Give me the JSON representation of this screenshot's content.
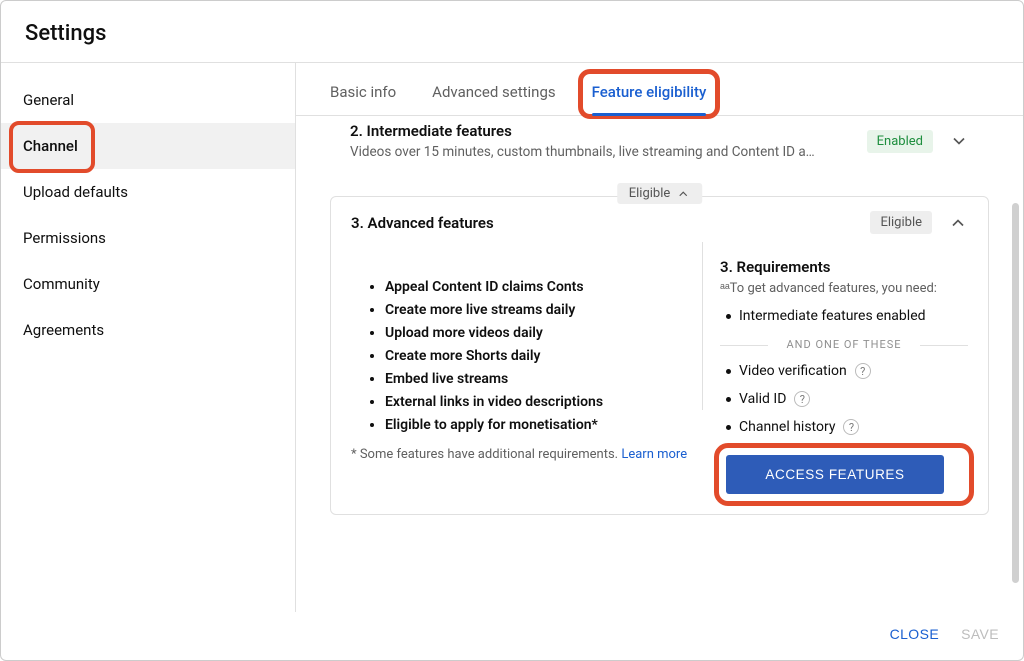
{
  "header": {
    "title": "Settings"
  },
  "sidebar": {
    "items": [
      {
        "label": "General"
      },
      {
        "label": "Channel"
      },
      {
        "label": "Upload defaults"
      },
      {
        "label": "Permissions"
      },
      {
        "label": "Community"
      },
      {
        "label": "Agreements"
      }
    ]
  },
  "tabs": [
    {
      "label": "Basic info"
    },
    {
      "label": "Advanced settings"
    },
    {
      "label": "Feature eligibility"
    }
  ],
  "intermediate": {
    "title": "2. Intermediate features",
    "subtitle": "Videos over 15 minutes, custom thumbnails, live streaming and Content ID a…",
    "status": "Enabled"
  },
  "advanced": {
    "eligible_pill": "Eligible",
    "title": "3. Advanced features",
    "status": "Eligible",
    "features": [
      "Appeal Content ID claims Conts",
      "Create more live streams daily",
      "Upload more videos daily",
      "Create more Shorts daily",
      "Embed live streams",
      "External links in video descriptions",
      "Eligible to apply for monetisation*"
    ],
    "footnote_text": "* Some features have additional requirements. ",
    "footnote_link": "Learn more",
    "requirements": {
      "title": "3. Requirements",
      "subtitle": "ᵃᵃTo get advanced features, you need:",
      "primary": "Intermediate features enabled",
      "and_label": "AND ONE OF THESE",
      "options": [
        "Video verification",
        "Valid ID",
        "Channel history"
      ],
      "button": "ACCESS FEATURES"
    }
  },
  "footer": {
    "close": "CLOSE",
    "save": "SAVE"
  }
}
